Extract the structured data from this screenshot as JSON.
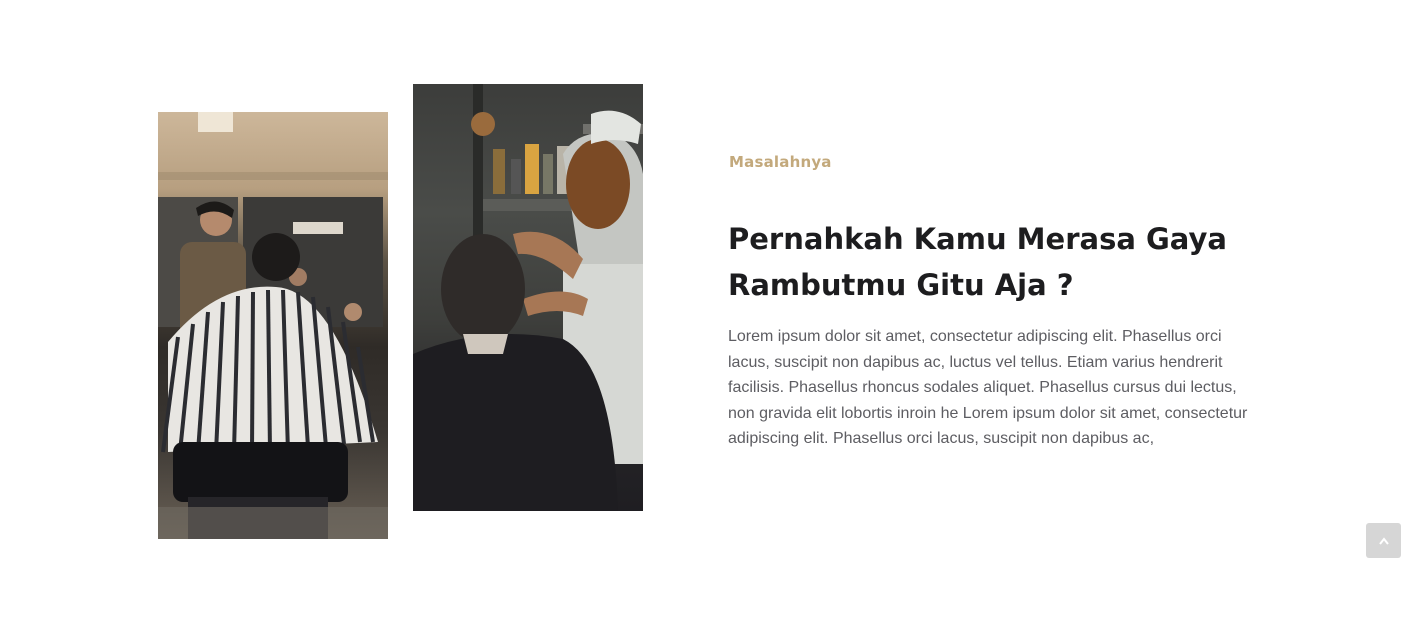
{
  "images": [
    {
      "alt": "barbershop-interior-photo"
    },
    {
      "alt": "barber-cutting-hair-photo"
    }
  ],
  "section": {
    "eyebrow": "Masalahnya",
    "heading": "Pernahkah Kamu Merasa Gaya Rambutmu Gitu Aja ?",
    "body": "Lorem ipsum dolor sit amet, consectetur adipiscing elit. Phasellus orci lacus, suscipit non dapibus ac, luctus vel tellus. Etiam varius hendrerit facilisis. Phasellus rhoncus sodales aliquet. Phasellus cursus dui lectus, non gravida elit lobortis inroin he Lorem ipsum dolor sit amet, consectetur adipiscing elit. Phasellus orci lacus, suscipit non dapibus ac,"
  },
  "scroll_top": {
    "icon": "chevron-up-icon"
  },
  "colors": {
    "accent": "#c3a97c",
    "heading": "#1d1d1f",
    "body": "#5d5d62",
    "scroll_button": "#d6d6d6"
  }
}
